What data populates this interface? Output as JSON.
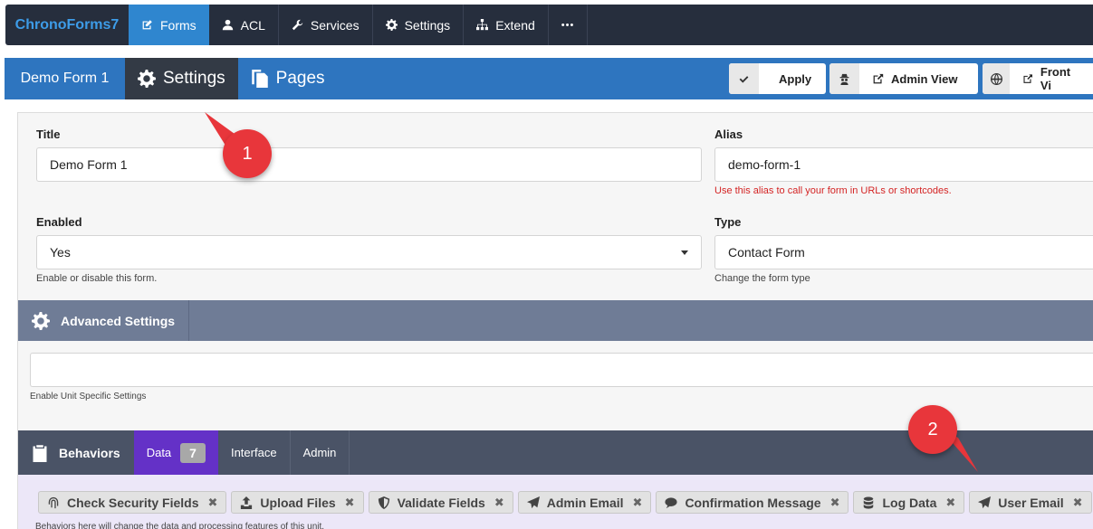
{
  "app": {
    "brand": "ChronoForms7"
  },
  "nav": [
    {
      "label": "Forms",
      "icon": "edit-icon",
      "active": true
    },
    {
      "label": "ACL",
      "icon": "user-icon"
    },
    {
      "label": "Services",
      "icon": "wrench-icon"
    },
    {
      "label": "Settings",
      "icon": "gear-icon"
    },
    {
      "label": "Extend",
      "icon": "sitemap-icon"
    },
    {
      "label": "•••",
      "icon": "more-icon"
    }
  ],
  "form_header": {
    "form_name": "Demo Form 1",
    "tabs": [
      {
        "label": "Settings",
        "icon": "gear-icon",
        "active": true
      },
      {
        "label": "Pages",
        "icon": "copy-icon"
      }
    ],
    "actions": [
      {
        "label": "Apply",
        "icon": "check-icon"
      },
      {
        "label": "Admin View",
        "icon": "external-link-icon",
        "side_icon": "user-secret-icon"
      },
      {
        "label": "Front Vi",
        "icon": "external-link-icon",
        "side_icon": "globe-icon"
      }
    ]
  },
  "settings": {
    "title_label": "Title",
    "title_value": "Demo Form 1",
    "alias_label": "Alias",
    "alias_value": "demo-form-1",
    "alias_help": "Use this alias to call your form in URLs or shortcodes.",
    "enabled_label": "Enabled",
    "enabled_value": "Yes",
    "enabled_help": "Enable or disable this form.",
    "type_label": "Type",
    "type_value": "Contact Form",
    "type_help": "Change the form type"
  },
  "advanced": {
    "title": "Advanced Settings",
    "input_value": "",
    "help": "Enable Unit Specific Settings"
  },
  "behaviors": {
    "title": "Behaviors",
    "tabs": [
      {
        "label": "Data",
        "count": "7",
        "active": true
      },
      {
        "label": "Interface"
      },
      {
        "label": "Admin"
      }
    ],
    "tags": [
      {
        "label": "Check Security Fields",
        "icon": "fingerprint-icon"
      },
      {
        "label": "Upload Files",
        "icon": "upload-icon"
      },
      {
        "label": "Validate Fields",
        "icon": "shield-icon"
      },
      {
        "label": "Admin Email",
        "icon": "paper-plane-icon"
      },
      {
        "label": "Confirmation Message",
        "icon": "comment-icon"
      },
      {
        "label": "Log Data",
        "icon": "database-icon"
      },
      {
        "label": "User Email",
        "icon": "paper-plane-icon"
      }
    ],
    "remove_glyph": "✖",
    "help": "Behaviors here will change the data and processing features of this unit."
  },
  "callouts": [
    "1",
    "2"
  ],
  "colors": {
    "nav_bg": "#262e3d",
    "brand": "#3d9ce8",
    "accent": "#2f86cf",
    "form_bar": "#2e75bf",
    "active_tab": "#6431c7",
    "callout": "#e8363b",
    "help_red": "#d42424"
  }
}
